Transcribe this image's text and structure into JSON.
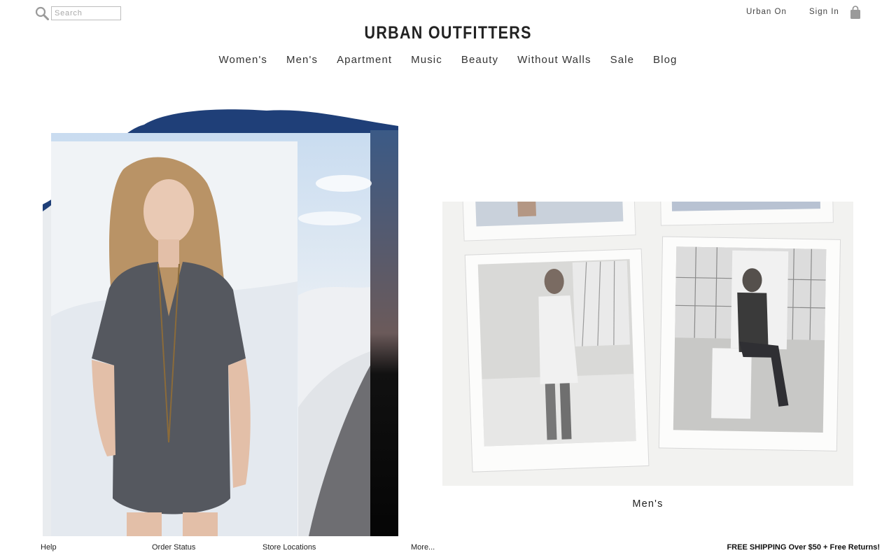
{
  "header": {
    "search": {
      "placeholder": "Search",
      "value": ""
    },
    "utility_links": [
      "Urban On",
      "Sign In"
    ],
    "logo": "URBAN OUTFITTERS"
  },
  "nav": {
    "items": [
      "Women's",
      "Men's",
      "Apartment",
      "Music",
      "Beauty",
      "Without Walls",
      "Sale",
      "Blog"
    ]
  },
  "promos": {
    "mens_caption": "Men's"
  },
  "footer": {
    "links": [
      "Help",
      "Order Status",
      "Store Locations",
      "More..."
    ],
    "shipping_message": "FREE SHIPPING Over $50 + Free Returns!"
  },
  "colors": {
    "brush_blue": "#1f3f78",
    "text": "#333333",
    "input_border": "#bdbdbd"
  },
  "icons": [
    "search-icon",
    "shopping-bag-icon"
  ]
}
